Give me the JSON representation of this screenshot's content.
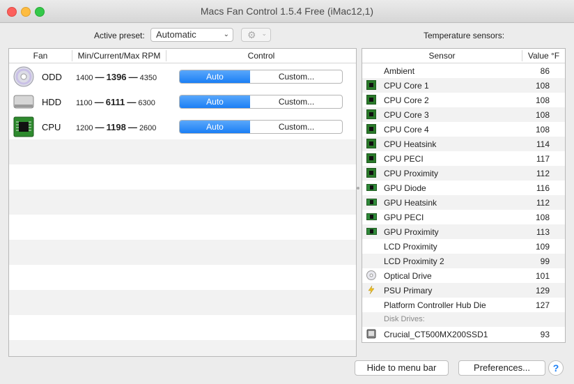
{
  "window": {
    "title": "Macs Fan Control 1.5.4 Free (iMac12,1)"
  },
  "toolbar": {
    "preset_label": "Active preset:",
    "preset_value": "Automatic",
    "sensors_title": "Temperature sensors:"
  },
  "fans_table": {
    "headers": {
      "fan": "Fan",
      "rpm": "Min/Current/Max RPM",
      "control": "Control"
    },
    "rows": [
      {
        "name": "ODD",
        "min": "1400",
        "current": "1396",
        "max": "4350",
        "sep": "—",
        "auto": "Auto",
        "custom": "Custom...",
        "icon": "optical-disc-icon"
      },
      {
        "name": "HDD",
        "min": "1100",
        "current": "6111",
        "max": "6300",
        "sep": "—",
        "auto": "Auto",
        "custom": "Custom...",
        "icon": "hard-drive-icon"
      },
      {
        "name": "CPU",
        "min": "1200",
        "current": "1198",
        "max": "2600",
        "sep": "—",
        "auto": "Auto",
        "custom": "Custom...",
        "icon": "cpu-chip-icon"
      }
    ]
  },
  "sensors_table": {
    "headers": {
      "sensor": "Sensor",
      "value": "Value °F"
    },
    "rows": [
      {
        "name": "Ambient",
        "value": "86",
        "icon": "none"
      },
      {
        "name": "CPU Core 1",
        "value": "108",
        "icon": "cpu-chip-icon"
      },
      {
        "name": "CPU Core 2",
        "value": "108",
        "icon": "cpu-chip-icon"
      },
      {
        "name": "CPU Core 3",
        "value": "108",
        "icon": "cpu-chip-icon"
      },
      {
        "name": "CPU Core 4",
        "value": "108",
        "icon": "cpu-chip-icon"
      },
      {
        "name": "CPU Heatsink",
        "value": "114",
        "icon": "cpu-chip-icon"
      },
      {
        "name": "CPU PECI",
        "value": "117",
        "icon": "cpu-chip-icon"
      },
      {
        "name": "CPU Proximity",
        "value": "112",
        "icon": "cpu-chip-icon"
      },
      {
        "name": "GPU Diode",
        "value": "116",
        "icon": "gpu-card-icon"
      },
      {
        "name": "GPU Heatsink",
        "value": "112",
        "icon": "gpu-card-icon"
      },
      {
        "name": "GPU PECI",
        "value": "108",
        "icon": "gpu-card-icon"
      },
      {
        "name": "GPU Proximity",
        "value": "113",
        "icon": "gpu-card-icon"
      },
      {
        "name": "LCD Proximity",
        "value": "109",
        "icon": "none"
      },
      {
        "name": "LCD Proximity 2",
        "value": "99",
        "icon": "none"
      },
      {
        "name": "Optical Drive",
        "value": "101",
        "icon": "optical-disc-icon"
      },
      {
        "name": "PSU Primary",
        "value": "129",
        "icon": "lightning-bolt-icon"
      },
      {
        "name": "Platform Controller Hub Die",
        "value": "127",
        "icon": "none"
      }
    ],
    "section_label": "Disk Drives:",
    "disk_rows": [
      {
        "name": "Crucial_CT500MX200SSD1",
        "value": "93",
        "icon": "hard-drive-icon"
      }
    ]
  },
  "footer": {
    "hide_label": "Hide to menu bar",
    "prefs_label": "Preferences...",
    "help_label": "?"
  },
  "colors": {
    "accent": "#1b7ff5",
    "chip_green": "#2a7a2a",
    "stripe": "#f2f2f2"
  }
}
